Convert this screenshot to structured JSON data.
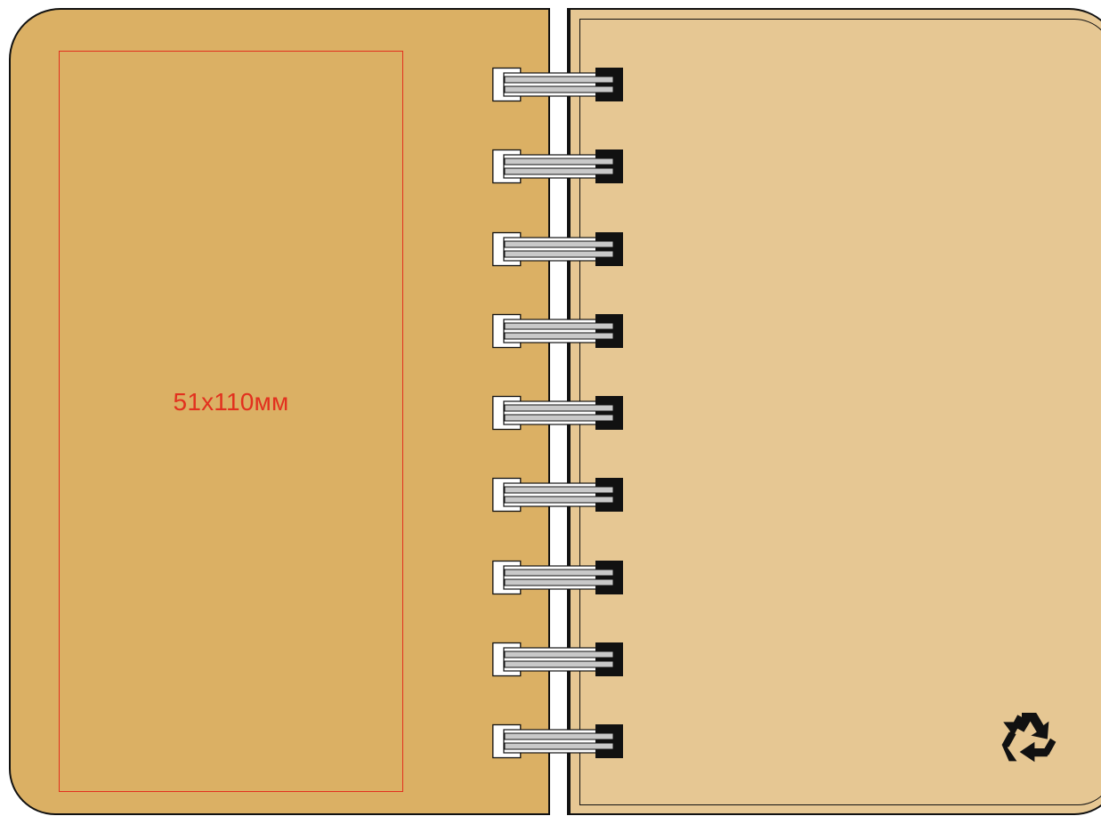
{
  "notebook": {
    "colors": {
      "cover_left": "#dbb064",
      "cover_right": "#e6c793",
      "outline": "#111111",
      "print_area": "#e2301e",
      "coil_wire": "#c9c9c9",
      "coil_end": "#111111"
    },
    "print_area": {
      "label": "51x110мм"
    },
    "binding": {
      "ring_count": 9
    },
    "icons": {
      "recycle": "recycle-icon"
    }
  }
}
